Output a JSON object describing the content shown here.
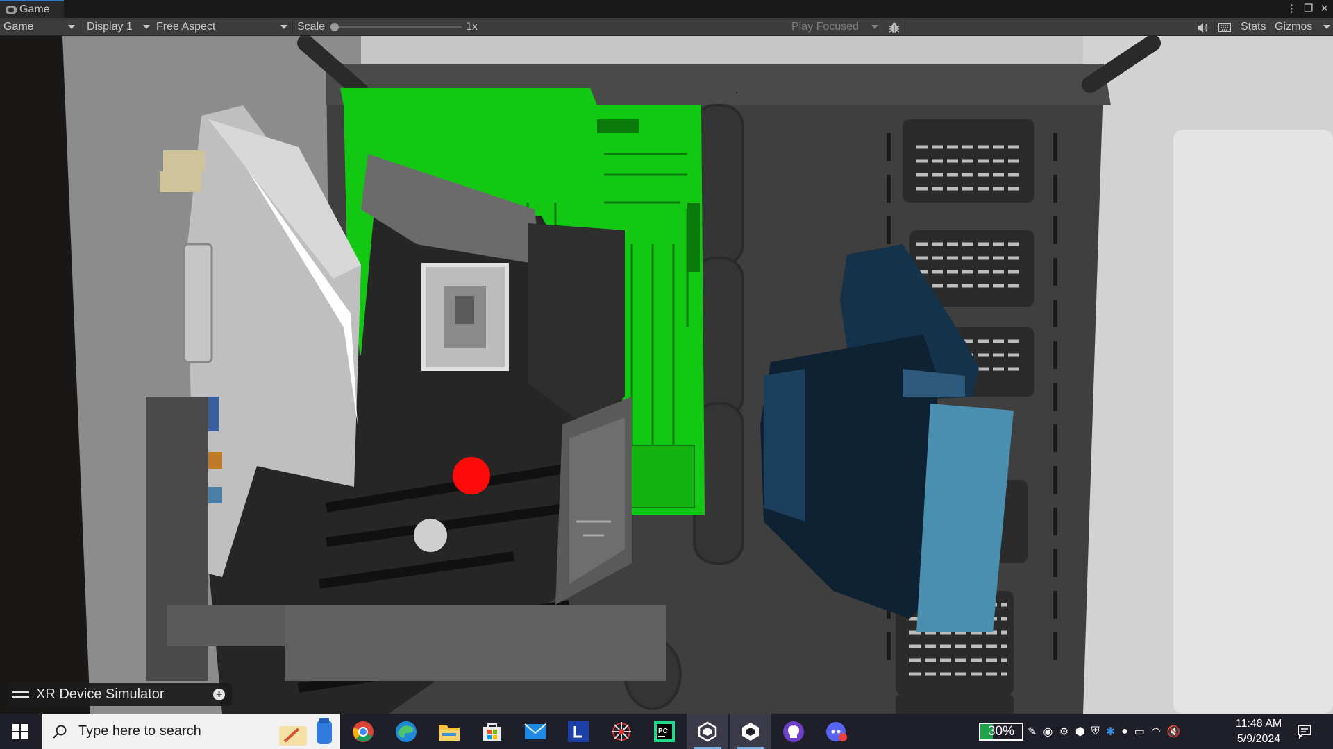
{
  "editor": {
    "tab_label": "Game",
    "tab_icon": "gamepad-icon",
    "window_controls": [
      "more-options-icon",
      "maximize-icon",
      "close-icon"
    ]
  },
  "toolbar": {
    "view_select": "Game",
    "display_select": "Display 1",
    "aspect_select": "Free Aspect",
    "scale_label": "Scale",
    "scale_value": "1x",
    "scale_fraction": 0,
    "play_mode_select": "Play Focused",
    "bug_icon": "bug-icon",
    "audio_icon": "speaker-icon",
    "layout_icon": "keyboard-icon",
    "stats_label": "Stats",
    "gizmos_label": "Gizmos"
  },
  "scene": {
    "highlight_color": "#12c812",
    "pointer_color": "#ff0a0a",
    "fan_color": "#4a8fb0"
  },
  "xr_overlay": {
    "title": "XR Device Simulator",
    "handle_icon": "drag-handle-icon",
    "expand_icon": "plus-circle-icon"
  },
  "taskbar": {
    "search_placeholder": "Type here to search",
    "apps": [
      "chrome-icon",
      "edge-icon",
      "file-explorer-icon",
      "microsoft-store-icon",
      "mail-icon",
      "l-app-icon",
      "spider-app-icon",
      "pycharm-icon",
      "unity-hub-icon",
      "unity-icon",
      "github-desktop-icon",
      "discord-icon"
    ],
    "battery_percent": "30%",
    "clock_time": "11:48 AM",
    "clock_date": "5/9/2024"
  }
}
